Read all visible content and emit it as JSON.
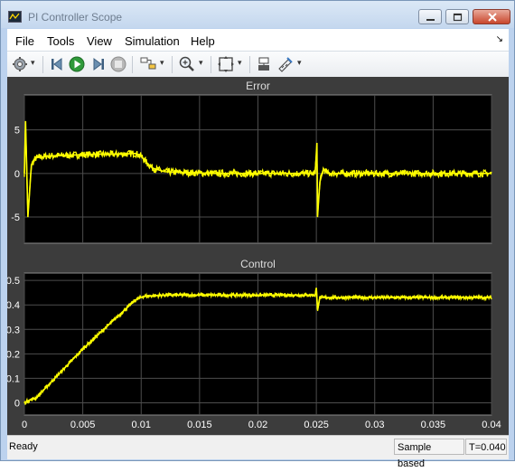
{
  "window": {
    "title": "PI Controller Scope"
  },
  "menu": {
    "items": [
      "File",
      "Tools",
      "View",
      "Simulation",
      "Help"
    ]
  },
  "toolbar": {
    "icons": [
      "gear-icon",
      "step-back-icon",
      "run-icon",
      "step-forward-icon",
      "stop-icon",
      "signal-select-icon",
      "zoom-icon",
      "autoscale-icon",
      "highlight-block-icon",
      "measure-icon"
    ]
  },
  "colors": {
    "trace": "#ffff00",
    "axes_bg": "#000000",
    "figure_bg": "#3c3c3c",
    "grid": "#4d4d4d",
    "text": "#ffffff"
  },
  "chart_data": [
    {
      "type": "line",
      "title": "Error",
      "xlim": [
        0,
        0.04
      ],
      "ylim": [
        -8,
        9
      ],
      "yticks": [
        -5,
        0,
        5
      ],
      "xticks": [
        0,
        0.005,
        0.01,
        0.015,
        0.02,
        0.025,
        0.03,
        0.035,
        0.04
      ],
      "grid": true,
      "series": [
        {
          "x": [
            0,
            0.0001,
            0.0003,
            0.0006,
            0.001,
            0.002,
            0.004,
            0.006,
            0.008,
            0.0095,
            0.01,
            0.0105,
            0.011,
            0.012,
            0.014,
            0.016,
            0.02,
            0.024,
            0.0249,
            0.02505,
            0.0251,
            0.0253,
            0.0256,
            0.026,
            0.03,
            0.035,
            0.04
          ],
          "y": [
            0,
            6,
            -5,
            1,
            1.8,
            2,
            2.1,
            2.2,
            2.2,
            2.3,
            2.0,
            1.2,
            0.6,
            0.2,
            0.1,
            0,
            0,
            0,
            0,
            3.5,
            -5,
            -1,
            0.5,
            0,
            0,
            0,
            0
          ],
          "noise": 0.4
        }
      ]
    },
    {
      "type": "line",
      "title": "Control",
      "xlim": [
        0,
        0.04
      ],
      "ylim": [
        -0.05,
        0.53
      ],
      "yticks": [
        0,
        0.1,
        0.2,
        0.3,
        0.4,
        0.5
      ],
      "xticks": [
        0,
        0.005,
        0.01,
        0.015,
        0.02,
        0.025,
        0.03,
        0.035,
        0.04
      ],
      "xticklabels": [
        "0",
        "0.005",
        "0.01",
        "0.015",
        "0.02",
        "0.025",
        "0.03",
        "0.035",
        "0.04"
      ],
      "grid": true,
      "series": [
        {
          "x": [
            0,
            0.0004,
            0.001,
            0.005,
            0.0095,
            0.0102,
            0.012,
            0.02,
            0.0249,
            0.025,
            0.0251,
            0.0253,
            0.0256,
            0.03,
            0.04
          ],
          "y": [
            0.0,
            0.01,
            0.02,
            0.22,
            0.42,
            0.435,
            0.44,
            0.44,
            0.44,
            0.47,
            0.38,
            0.43,
            0.43,
            0.43,
            0.43
          ],
          "noise": 0.008
        }
      ]
    }
  ],
  "status": {
    "ready": "Ready",
    "mode": "Sample based",
    "time": "T=0.040"
  }
}
